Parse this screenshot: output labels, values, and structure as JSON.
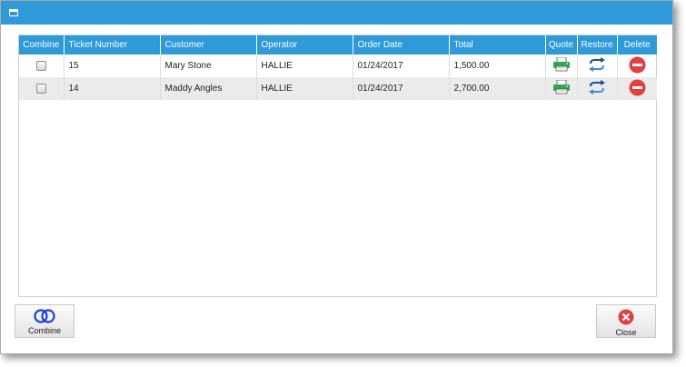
{
  "columns": {
    "combine": "Combine",
    "ticket_number": "Ticket Number",
    "customer": "Customer",
    "operator": "Operator",
    "order_date": "Order Date",
    "total": "Total",
    "quote": "Quote",
    "restore": "Restore",
    "delete": "Delete"
  },
  "rows": [
    {
      "checked": false,
      "ticket_number": "15",
      "customer": "Mary Stone",
      "operator": "HALLIE",
      "order_date": "01/24/2017",
      "total": "1,500.00"
    },
    {
      "checked": false,
      "ticket_number": "14",
      "customer": "Maddy Angles",
      "operator": "HALLIE",
      "order_date": "01/24/2017",
      "total": "2,700.00"
    }
  ],
  "icons": {
    "window": "window-icon",
    "quote": "printer-icon",
    "restore": "restore-arrows-icon",
    "delete": "remove-circle-icon",
    "combine": "overlapping-rings-icon",
    "close": "close-circle-icon"
  },
  "buttons": {
    "combine_label": "Combine",
    "close_label": "Close"
  },
  "colors": {
    "accent": "#2f9ad8",
    "alt_row": "#ebebeb",
    "printer_green": "#2fa84f",
    "restore_blue": "#1e4f8f",
    "delete_red": "#e04040",
    "combine_blue": "#1a3fd8"
  }
}
